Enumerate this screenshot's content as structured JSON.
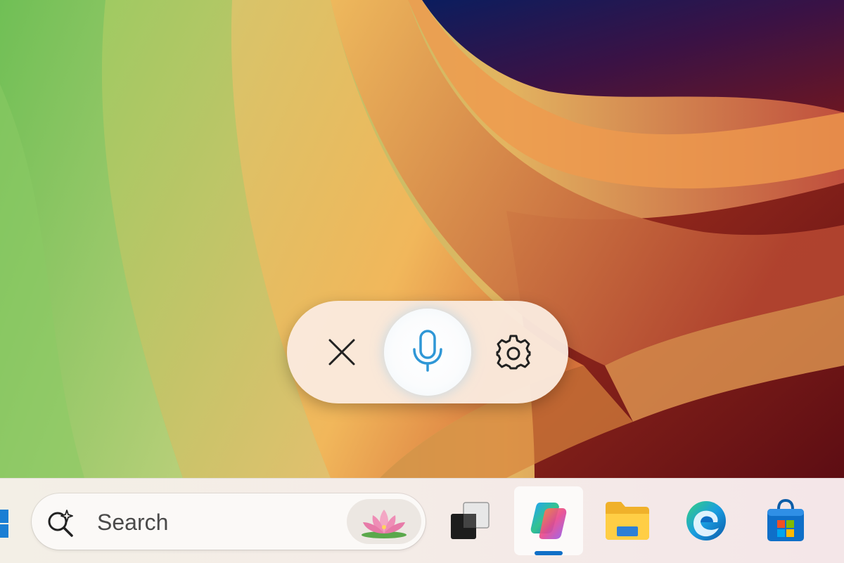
{
  "voice_bar": {
    "close_icon": "close-icon",
    "mic_icon": "microphone-icon",
    "settings_icon": "gear-icon",
    "accent_color": "#2f97d6"
  },
  "taskbar": {
    "search": {
      "placeholder": "Search",
      "icon": "search-sparkle-icon",
      "highlight_icon": "lotus-flower-icon"
    },
    "apps": [
      {
        "name": "task-view",
        "icon": "task-view-icon"
      },
      {
        "name": "copilot",
        "icon": "copilot-icon",
        "active": true
      },
      {
        "name": "file-explorer",
        "icon": "folder-icon"
      },
      {
        "name": "edge",
        "icon": "edge-browser-icon"
      },
      {
        "name": "microsoft-store",
        "icon": "store-bag-icon"
      }
    ],
    "active_indicator_color": "#1070c7"
  }
}
